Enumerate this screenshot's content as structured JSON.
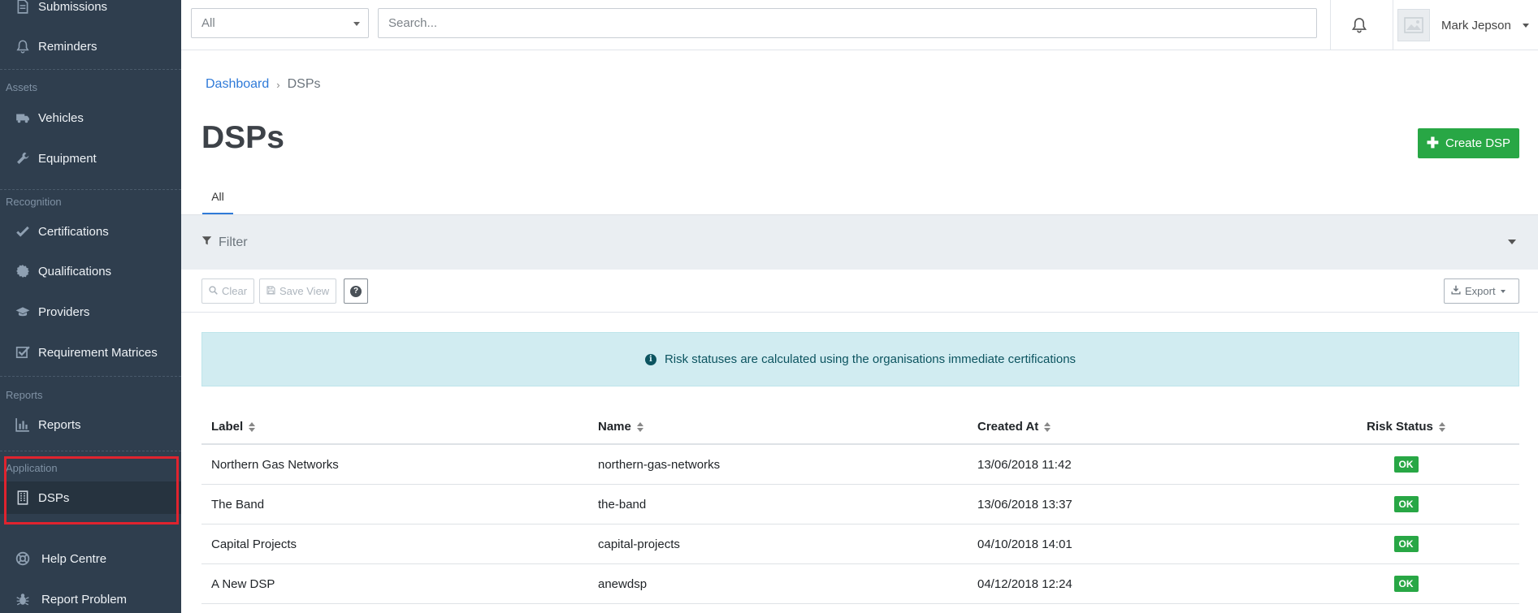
{
  "sidebar": {
    "items": [
      {
        "label": "Submissions",
        "icon": "document-icon"
      },
      {
        "label": "Reminders",
        "icon": "bell-icon"
      },
      {
        "label": "Vehicles",
        "icon": "truck-icon"
      },
      {
        "label": "Equipment",
        "icon": "wrench-icon"
      },
      {
        "label": "Certifications",
        "icon": "check-icon"
      },
      {
        "label": "Qualifications",
        "icon": "gear-badge-icon"
      },
      {
        "label": "Providers",
        "icon": "graduation-cap-icon"
      },
      {
        "label": "Requirement Matrices",
        "icon": "checkbox-icon"
      },
      {
        "label": "Reports",
        "icon": "bar-chart-icon"
      },
      {
        "label": "DSPs",
        "icon": "building-icon"
      },
      {
        "label": "Help Centre",
        "icon": "lifebuoy-icon"
      },
      {
        "label": "Report Problem",
        "icon": "bug-icon"
      }
    ],
    "sections": {
      "assets": "Assets",
      "recognition": "Recognition",
      "reports": "Reports",
      "application": "Application"
    },
    "active_item": "DSPs"
  },
  "topbar": {
    "scope_select": "All",
    "search_placeholder": "Search...",
    "user_name": "Mark Jepson"
  },
  "breadcrumb": {
    "home": "Dashboard",
    "current": "DSPs"
  },
  "page": {
    "title": "DSPs",
    "create_button": "Create DSP",
    "tab_all": "All"
  },
  "filter": {
    "label": "Filter"
  },
  "toolbar": {
    "clear_label": "Clear",
    "save_view_label": "Save View",
    "help_label": "?",
    "export_label": "Export"
  },
  "alert": {
    "message": "Risk statuses are calculated using the organisations immediate certifications"
  },
  "table": {
    "columns": [
      "Label",
      "Name",
      "Created At",
      "Risk Status"
    ],
    "rows": [
      {
        "label": "Northern Gas Networks",
        "name": "northern-gas-networks",
        "created_at": "13/06/2018 11:42",
        "risk": "OK"
      },
      {
        "label": "The Band",
        "name": "the-band",
        "created_at": "13/06/2018 13:37",
        "risk": "OK"
      },
      {
        "label": "Capital Projects",
        "name": "capital-projects",
        "created_at": "04/10/2018 14:01",
        "risk": "OK"
      },
      {
        "label": "A New DSP",
        "name": "anewdsp",
        "created_at": "04/12/2018 12:24",
        "risk": "OK"
      }
    ]
  },
  "colors": {
    "sidebar_bg": "#2f3e4e",
    "accent": "#2f7ad8",
    "success": "#28a745",
    "highlight": "#e0232e"
  }
}
